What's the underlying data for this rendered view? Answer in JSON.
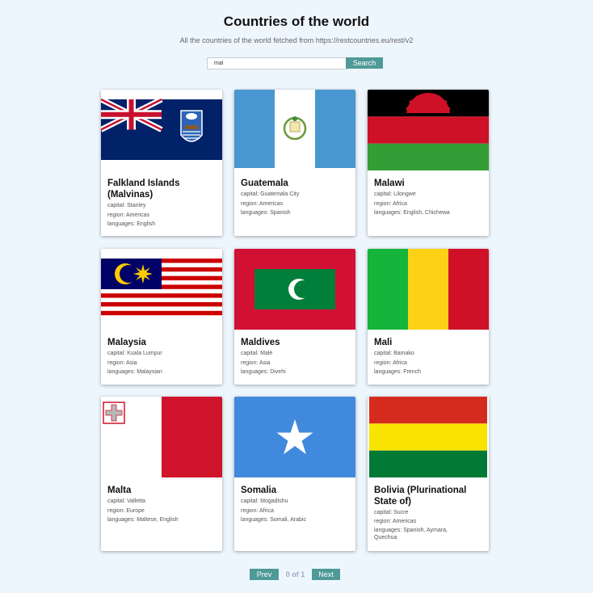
{
  "header": {
    "title": "Countries of the world",
    "subtitle": "All the countries of the world fetched from https://restcountries.eu/rest/v2"
  },
  "search": {
    "value": "mal",
    "button_label": "Search"
  },
  "countries": [
    {
      "name": "Falkland Islands (Malvinas)",
      "capital": "capital: Stanley",
      "region": "region: Americas",
      "languages": "languages: English",
      "flag": "falkland-islands-flag"
    },
    {
      "name": "Guatemala",
      "capital": "capital: Guatemala City",
      "region": "region: Americas",
      "languages": "languages: Spanish",
      "flag": "guatemala-flag"
    },
    {
      "name": "Malawi",
      "capital": "capital: Lilongwe",
      "region": "region: Africa",
      "languages": "languages: English, Chichewa",
      "flag": "malawi-flag"
    },
    {
      "name": "Malaysia",
      "capital": "capital: Kuala Lumpur",
      "region": "region: Asia",
      "languages": "languages: Malaysian",
      "flag": "malaysia-flag"
    },
    {
      "name": "Maldives",
      "capital": "capital: Malé",
      "region": "region: Asia",
      "languages": "languages: Divehi",
      "flag": "maldives-flag"
    },
    {
      "name": "Mali",
      "capital": "capital: Bamako",
      "region": "region: Africa",
      "languages": "languages: French",
      "flag": "mali-flag"
    },
    {
      "name": "Malta",
      "capital": "capital: Valletta",
      "region": "region: Europe",
      "languages": "languages: Maltese, English",
      "flag": "malta-flag"
    },
    {
      "name": "Somalia",
      "capital": "capital: Mogadishu",
      "region": "region: Africa",
      "languages": "languages: Somali, Arabic",
      "flag": "somalia-flag"
    },
    {
      "name": "Bolivia (Plurinational State of)",
      "capital": "capital: Sucre",
      "region": "region: Americas",
      "languages": "languages: Spanish, Aymara, Quechua",
      "flag": "bolivia-flag"
    }
  ],
  "pagination": {
    "prev_label": "Prev",
    "page_info": "0 of 1",
    "next_label": "Next"
  },
  "colors": {
    "accent": "#4f9a98",
    "background": "#eef6fd"
  }
}
